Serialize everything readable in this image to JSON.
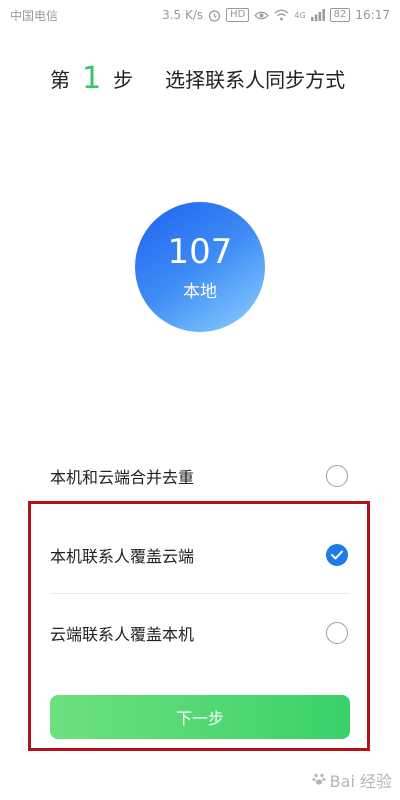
{
  "status_bar": {
    "carrier": "中国电信",
    "speed": "3.5 K/s",
    "hd_badge": "HD",
    "signal_tag": "4G",
    "battery": "82",
    "time": "16:17"
  },
  "header": {
    "step_prefix": "第",
    "step_number": "1",
    "step_suffix": "步",
    "title": "选择联系人同步方式"
  },
  "contacts": {
    "count": "107",
    "label": "本地"
  },
  "options": [
    {
      "label": "本机和云端合并去重",
      "selected": false
    },
    {
      "label": "本机联系人覆盖云端",
      "selected": true
    },
    {
      "label": "云端联系人覆盖本机",
      "selected": false
    }
  ],
  "next_button": {
    "label": "下一步"
  },
  "watermark": {
    "text": "Bai 经验"
  },
  "colors": {
    "accent_green": "#36c56a",
    "radio_blue": "#1f7be8",
    "highlight_red": "#b3121a"
  }
}
